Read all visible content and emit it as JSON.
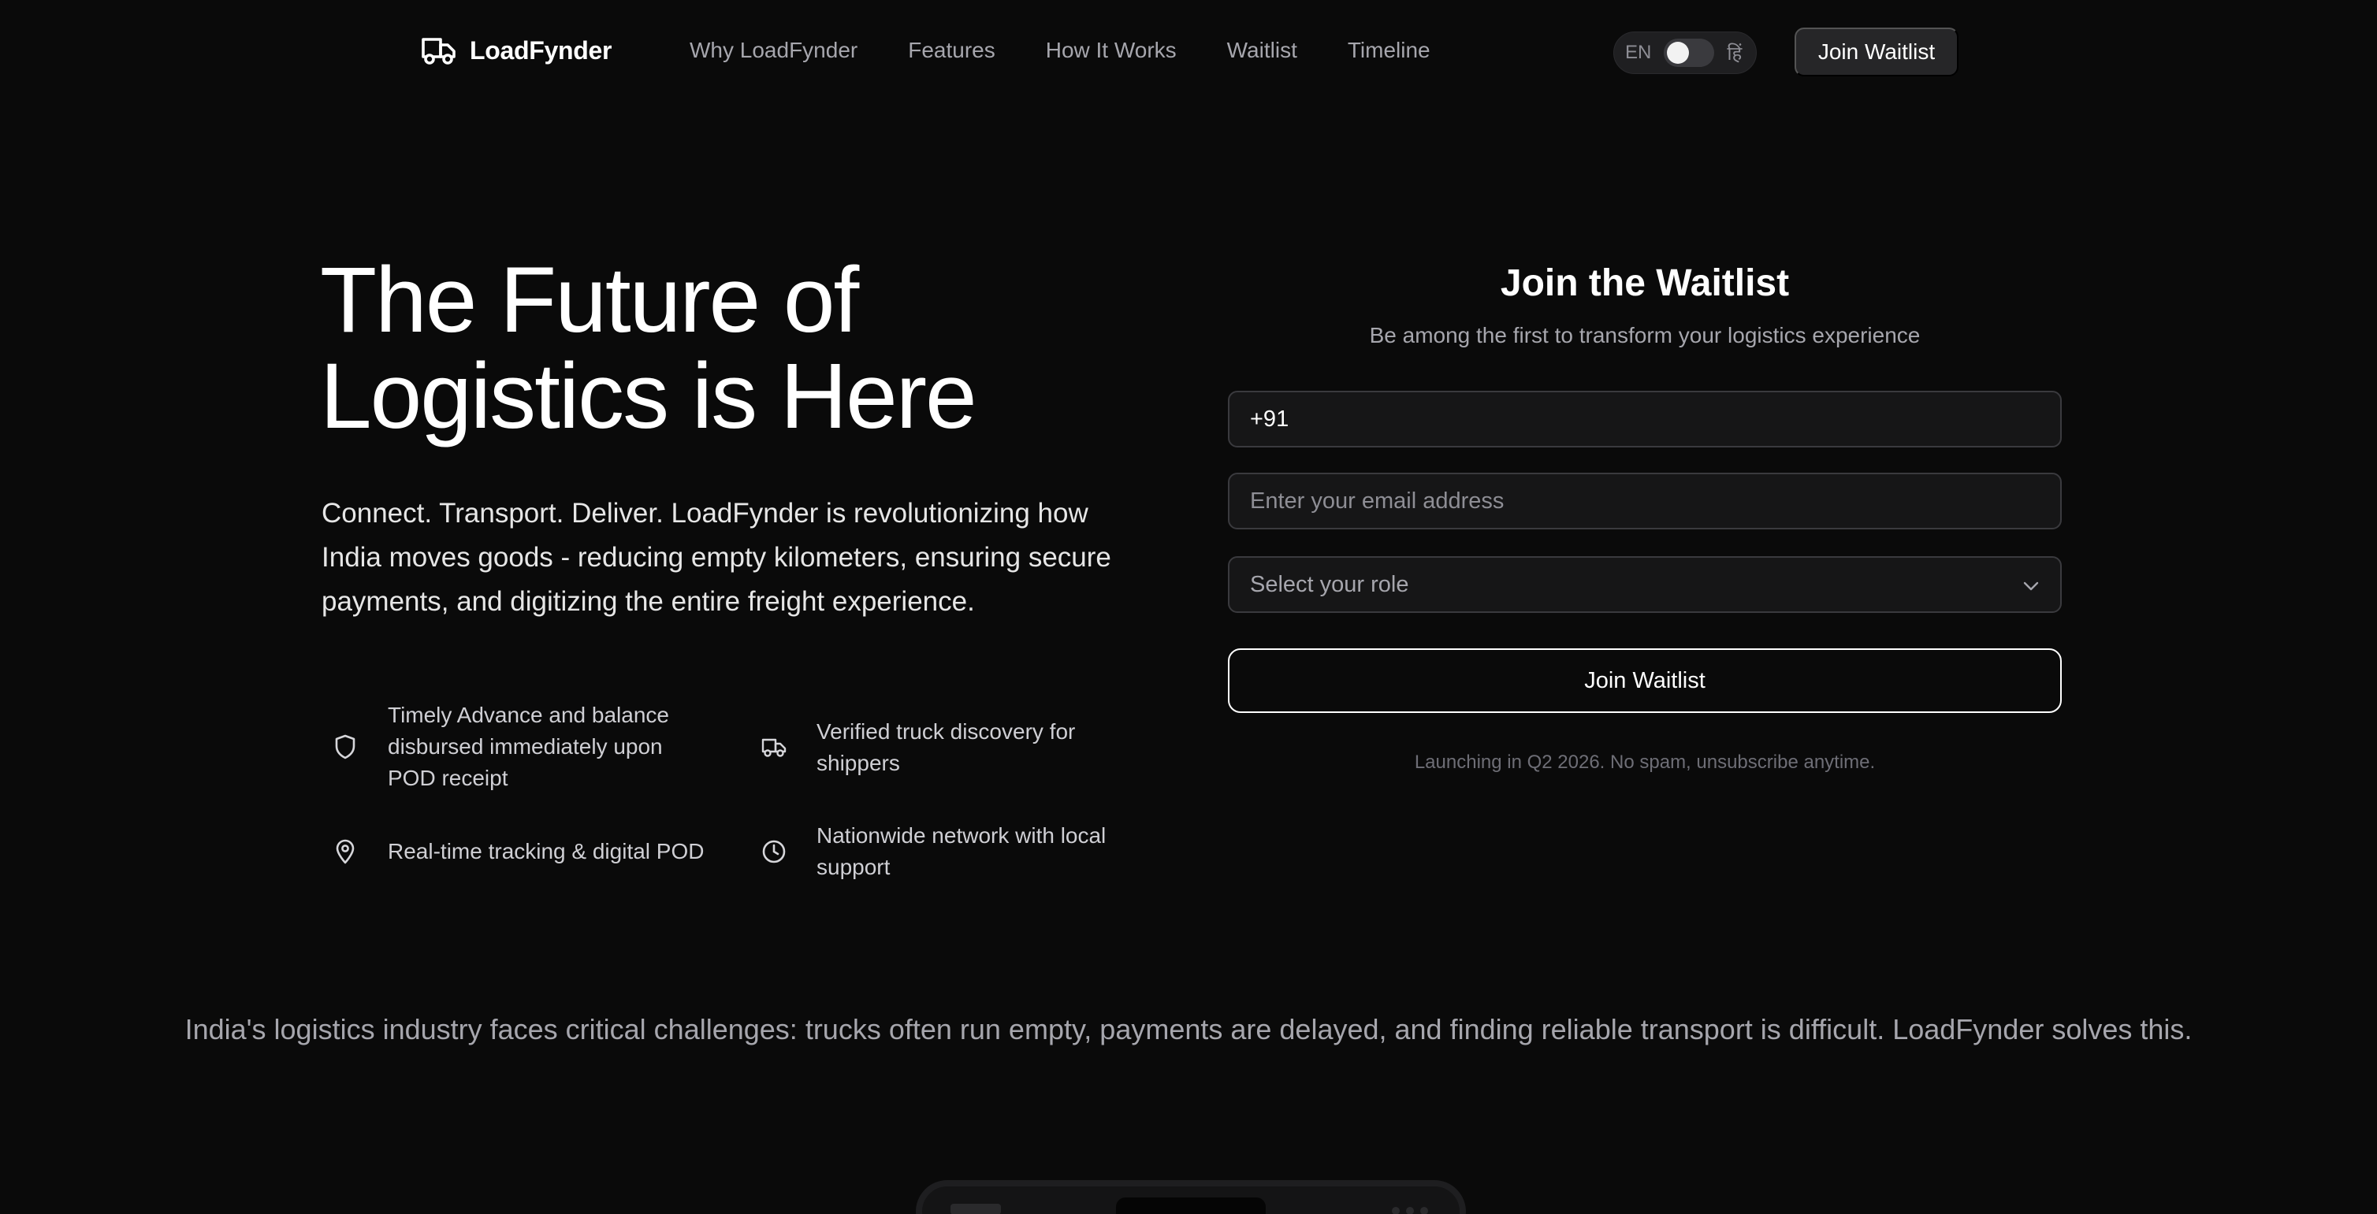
{
  "nav": {
    "brand": "LoadFynder",
    "links": [
      "Why LoadFynder",
      "Features",
      "How It Works",
      "Waitlist",
      "Timeline"
    ],
    "lang": {
      "left": "EN",
      "right": "हिं",
      "state": "EN"
    },
    "cta": "Join Waitlist"
  },
  "hero": {
    "title_line1": "The Future of",
    "title_line2": "Logistics is Here",
    "description": "Connect. Transport. Deliver. LoadFynder is revolutionizing how India moves goods - reducing empty kilometers, ensuring secure payments, and digitizing the entire freight experience.",
    "features": [
      {
        "icon": "shield-icon",
        "text": "Timely Advance and balance disbursed immediately upon POD receipt"
      },
      {
        "icon": "truck-icon",
        "text": "Verified truck discovery for shippers"
      },
      {
        "icon": "map-pin-icon",
        "text": "Real-time tracking & digital POD"
      },
      {
        "icon": "clock-icon",
        "text": "Nationwide network with local support"
      }
    ]
  },
  "form": {
    "title": "Join the Waitlist",
    "subtitle": "Be among the first to transform your logistics experience",
    "phone_value": "+91",
    "email_placeholder": "Enter your email address",
    "role_placeholder": "Select your role",
    "submit": "Join Waitlist",
    "note": "Launching in Q2 2026. No spam, unsubscribe anytime."
  },
  "problem": "India's logistics industry faces critical challenges: trucks often run empty, payments are delayed, and finding reliable transport is difficult. LoadFynder solves this.",
  "colors": {
    "background": "#0a0a0a",
    "text": "#ffffff",
    "muted": "#a6a6ad",
    "field_border": "#3a3a3e"
  }
}
